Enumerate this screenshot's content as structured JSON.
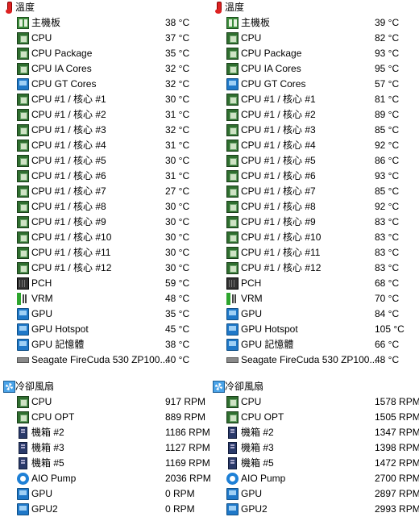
{
  "left": {
    "temps": {
      "title": "溫度",
      "items": [
        {
          "icon": "motherboard-icon",
          "label": "主機板",
          "value": "38 °C"
        },
        {
          "icon": "chip-icon",
          "label": "CPU",
          "value": "37 °C"
        },
        {
          "icon": "chip-icon",
          "label": "CPU Package",
          "value": "35 °C"
        },
        {
          "icon": "chip-icon",
          "label": "CPU IA Cores",
          "value": "32 °C"
        },
        {
          "icon": "monitor-icon",
          "label": "CPU GT Cores",
          "value": "32 °C"
        },
        {
          "icon": "chip-icon",
          "label": "CPU #1 / 核心 #1",
          "value": "30 °C"
        },
        {
          "icon": "chip-icon",
          "label": "CPU #1 / 核心 #2",
          "value": "31 °C"
        },
        {
          "icon": "chip-icon",
          "label": "CPU #1 / 核心 #3",
          "value": "32 °C"
        },
        {
          "icon": "chip-icon",
          "label": "CPU #1 / 核心 #4",
          "value": "31 °C"
        },
        {
          "icon": "chip-icon",
          "label": "CPU #1 / 核心 #5",
          "value": "30 °C"
        },
        {
          "icon": "chip-icon",
          "label": "CPU #1 / 核心 #6",
          "value": "31 °C"
        },
        {
          "icon": "chip-icon",
          "label": "CPU #1 / 核心 #7",
          "value": "27 °C"
        },
        {
          "icon": "chip-icon",
          "label": "CPU #1 / 核心 #8",
          "value": "30 °C"
        },
        {
          "icon": "chip-icon",
          "label": "CPU #1 / 核心 #9",
          "value": "30 °C"
        },
        {
          "icon": "chip-icon",
          "label": "CPU #1 / 核心 #10",
          "value": "30 °C"
        },
        {
          "icon": "chip-icon",
          "label": "CPU #1 / 核心 #11",
          "value": "30 °C"
        },
        {
          "icon": "chip-icon",
          "label": "CPU #1 / 核心 #12",
          "value": "30 °C"
        },
        {
          "icon": "pch-icon",
          "label": "PCH",
          "value": "59 °C"
        },
        {
          "icon": "vrm-icon",
          "label": "VRM",
          "value": "48 °C"
        },
        {
          "icon": "monitor-icon",
          "label": "GPU",
          "value": "35 °C"
        },
        {
          "icon": "monitor-icon",
          "label": "GPU Hotspot",
          "value": "45 °C"
        },
        {
          "icon": "monitor-icon",
          "label": "GPU 記憶體",
          "value": "38 °C"
        },
        {
          "icon": "disk-icon",
          "label": "Seagate FireCuda 530 ZP100...",
          "value": "40 °C"
        }
      ]
    },
    "fans": {
      "title": "冷卻風扇",
      "items": [
        {
          "icon": "chip-icon",
          "label": "CPU",
          "value": "917 RPM"
        },
        {
          "icon": "chip-icon",
          "label": "CPU OPT",
          "value": "889 RPM"
        },
        {
          "icon": "case-icon",
          "label": "機箱 #2",
          "value": "1186 RPM"
        },
        {
          "icon": "case-icon",
          "label": "機箱 #3",
          "value": "1127 RPM"
        },
        {
          "icon": "case-icon",
          "label": "機箱 #5",
          "value": "1169 RPM"
        },
        {
          "icon": "pump-icon",
          "label": "AIO Pump",
          "value": "2036 RPM"
        },
        {
          "icon": "monitor-icon",
          "label": "GPU",
          "value": "0 RPM"
        },
        {
          "icon": "monitor-icon",
          "label": "GPU2",
          "value": "0 RPM"
        }
      ]
    }
  },
  "right": {
    "temps": {
      "title": "溫度",
      "items": [
        {
          "icon": "motherboard-icon",
          "label": "主機板",
          "value": "39 °C"
        },
        {
          "icon": "chip-icon",
          "label": "CPU",
          "value": "82 °C"
        },
        {
          "icon": "chip-icon",
          "label": "CPU Package",
          "value": "93 °C"
        },
        {
          "icon": "chip-icon",
          "label": "CPU IA Cores",
          "value": "95 °C"
        },
        {
          "icon": "monitor-icon",
          "label": "CPU GT Cores",
          "value": "57 °C"
        },
        {
          "icon": "chip-icon",
          "label": "CPU #1 / 核心 #1",
          "value": "81 °C"
        },
        {
          "icon": "chip-icon",
          "label": "CPU #1 / 核心 #2",
          "value": "89 °C"
        },
        {
          "icon": "chip-icon",
          "label": "CPU #1 / 核心 #3",
          "value": "85 °C"
        },
        {
          "icon": "chip-icon",
          "label": "CPU #1 / 核心 #4",
          "value": "92 °C"
        },
        {
          "icon": "chip-icon",
          "label": "CPU #1 / 核心 #5",
          "value": "86 °C"
        },
        {
          "icon": "chip-icon",
          "label": "CPU #1 / 核心 #6",
          "value": "93 °C"
        },
        {
          "icon": "chip-icon",
          "label": "CPU #1 / 核心 #7",
          "value": "85 °C"
        },
        {
          "icon": "chip-icon",
          "label": "CPU #1 / 核心 #8",
          "value": "92 °C"
        },
        {
          "icon": "chip-icon",
          "label": "CPU #1 / 核心 #9",
          "value": "83 °C"
        },
        {
          "icon": "chip-icon",
          "label": "CPU #1 / 核心 #10",
          "value": "83 °C"
        },
        {
          "icon": "chip-icon",
          "label": "CPU #1 / 核心 #11",
          "value": "83 °C"
        },
        {
          "icon": "chip-icon",
          "label": "CPU #1 / 核心 #12",
          "value": "83 °C"
        },
        {
          "icon": "pch-icon",
          "label": "PCH",
          "value": "68 °C"
        },
        {
          "icon": "vrm-icon",
          "label": "VRM",
          "value": "70 °C"
        },
        {
          "icon": "monitor-icon",
          "label": "GPU",
          "value": "84 °C"
        },
        {
          "icon": "monitor-icon",
          "label": "GPU Hotspot",
          "value": "105 °C"
        },
        {
          "icon": "monitor-icon",
          "label": "GPU 記憶體",
          "value": "66 °C"
        },
        {
          "icon": "disk-icon",
          "label": "Seagate FireCuda 530 ZP100...",
          "value": "48 °C"
        }
      ]
    },
    "fans": {
      "title": "冷卻風扇",
      "items": [
        {
          "icon": "chip-icon",
          "label": "CPU",
          "value": "1578 RPM"
        },
        {
          "icon": "chip-icon",
          "label": "CPU OPT",
          "value": "1505 RPM"
        },
        {
          "icon": "case-icon",
          "label": "機箱 #2",
          "value": "1347 RPM"
        },
        {
          "icon": "case-icon",
          "label": "機箱 #3",
          "value": "1398 RPM"
        },
        {
          "icon": "case-icon",
          "label": "機箱 #5",
          "value": "1472 RPM"
        },
        {
          "icon": "pump-icon",
          "label": "AIO Pump",
          "value": "2700 RPM"
        },
        {
          "icon": "monitor-icon",
          "label": "GPU",
          "value": "2897 RPM"
        },
        {
          "icon": "monitor-icon",
          "label": "GPU2",
          "value": "2993 RPM"
        }
      ]
    }
  }
}
